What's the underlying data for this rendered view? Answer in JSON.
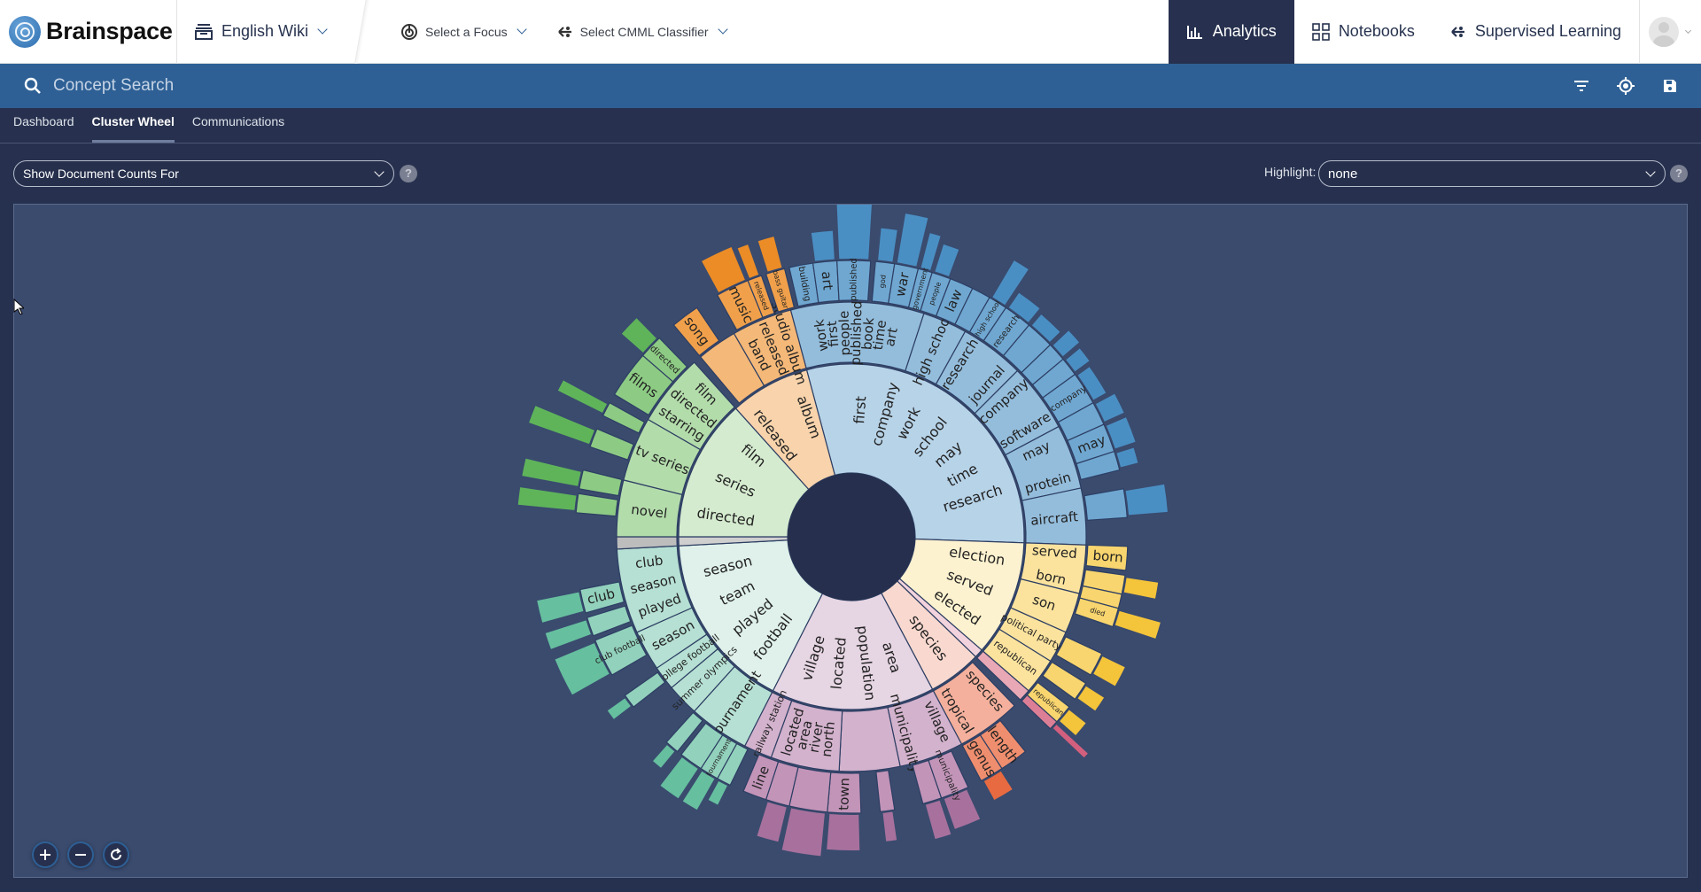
{
  "app": {
    "brand": "Brainspace"
  },
  "topbar": {
    "dataset": "English Wiki",
    "focus_select": "Select a Focus",
    "classifier_select": "Select CMML Classifier",
    "nav": [
      {
        "label": "Analytics",
        "icon": "bar-chart-icon",
        "active": true
      },
      {
        "label": "Notebooks",
        "icon": "grid-icon",
        "active": false
      },
      {
        "label": "Supervised Learning",
        "icon": "network-icon",
        "active": false
      }
    ]
  },
  "search": {
    "placeholder": "Concept Search",
    "value": ""
  },
  "tabs": [
    {
      "label": "Dashboard",
      "active": false
    },
    {
      "label": "Cluster Wheel",
      "active": true
    },
    {
      "label": "Communications",
      "active": false
    }
  ],
  "controls": {
    "doc_counts": "Show Document Counts For",
    "highlight_label": "Highlight:",
    "highlight_value": "none",
    "help": "?"
  },
  "colors": {
    "blue": [
      "#b7d3e8",
      "#94bddc",
      "#6fa7d1",
      "#4a8fc4"
    ],
    "orange": [
      "#f8d3ab",
      "#f4b878",
      "#f0a04b",
      "#eb8c26"
    ],
    "green": [
      "#d5ebcf",
      "#b3dcab",
      "#8dcb84",
      "#5fb45a"
    ],
    "mint": [
      "#dff1ea",
      "#b6e0d3",
      "#92d1bc",
      "#66bf9f"
    ],
    "lilac": [
      "#e6d5e3",
      "#d3b2cd",
      "#c294b8",
      "#a8719d"
    ],
    "peach": [
      "#f9d9cf",
      "#f4b09c",
      "#ef8e6e",
      "#e86a40"
    ],
    "pink": [
      "#f2d3dd",
      "#e9a8b6",
      "#dc7f96",
      "#d35f7e"
    ],
    "yellow": [
      "#fdf2d0",
      "#fbe39e",
      "#f8d56e",
      "#f4c43a"
    ],
    "gray": [
      "#cfcfcf",
      "#bdbdbd",
      "#aaaaaa",
      "#999999"
    ]
  },
  "chart_data": {
    "type": "sunburst",
    "title": "Cluster Wheel",
    "inner": [
      {
        "start": 345,
        "end": 92,
        "c": "blue",
        "labels": [
          "first",
          "company",
          "work",
          "school",
          "may",
          "time",
          "research"
        ]
      },
      {
        "start": 92,
        "end": 131,
        "c": "yellow",
        "labels": [
          "election",
          "served",
          "elected"
        ]
      },
      {
        "start": 131,
        "end": 134,
        "c": "pink",
        "labels": []
      },
      {
        "start": 134,
        "end": 152,
        "c": "peach",
        "labels": [
          "species"
        ]
      },
      {
        "start": 152,
        "end": 207,
        "c": "lilac",
        "labels": [
          "area",
          "population",
          "located",
          "village"
        ]
      },
      {
        "start": 207,
        "end": 267,
        "c": "mint",
        "labels": [
          "football",
          "played",
          "team",
          "season"
        ]
      },
      {
        "start": 267,
        "end": 270,
        "c": "gray",
        "labels": []
      },
      {
        "start": 270,
        "end": 318,
        "c": "green",
        "labels": [
          "directed",
          "series",
          "film"
        ]
      },
      {
        "start": 318,
        "end": 345,
        "c": "orange",
        "labels": [
          "released",
          "album"
        ]
      }
    ],
    "middle": [
      {
        "start": 345,
        "end": 18,
        "c": "blue",
        "labels": [
          "work",
          "first",
          "people",
          "published",
          "book",
          "time",
          "art"
        ]
      },
      {
        "start": 18,
        "end": 29,
        "c": "blue",
        "labels": [
          "high school"
        ]
      },
      {
        "start": 29,
        "end": 45,
        "c": "blue",
        "labels": [
          "research",
          "journal"
        ]
      },
      {
        "start": 45,
        "end": 62,
        "c": "blue",
        "labels": [
          "company",
          "software"
        ]
      },
      {
        "start": 62,
        "end": 78,
        "c": "blue",
        "labels": [
          "may",
          "protein"
        ]
      },
      {
        "start": 78,
        "end": 92,
        "c": "blue",
        "labels": [
          "aircraft"
        ]
      },
      {
        "start": 92,
        "end": 104,
        "c": "yellow",
        "labels": [
          "served",
          "born"
        ]
      },
      {
        "start": 104,
        "end": 114,
        "c": "yellow",
        "labels": [
          "son"
        ]
      },
      {
        "start": 114,
        "end": 122,
        "c": "yellow",
        "labels": [
          "political party"
        ]
      },
      {
        "start": 122,
        "end": 131,
        "c": "yellow",
        "labels": [
          "republican"
        ]
      },
      {
        "start": 131,
        "end": 134,
        "c": "pink",
        "labels": []
      },
      {
        "start": 136,
        "end": 152,
        "c": "peach",
        "labels": [
          "species",
          "tropical"
        ]
      },
      {
        "start": 152,
        "end": 168,
        "c": "lilac",
        "labels": [
          "village",
          "municipality"
        ]
      },
      {
        "start": 168,
        "end": 183,
        "c": "lilac",
        "labels": []
      },
      {
        "start": 183,
        "end": 200,
        "c": "lilac",
        "labels": [
          "north",
          "river",
          "area",
          "located"
        ]
      },
      {
        "start": 200,
        "end": 207,
        "c": "lilac",
        "labels": [
          "railway station"
        ]
      },
      {
        "start": 207,
        "end": 222,
        "c": "mint",
        "labels": [
          "tournament"
        ]
      },
      {
        "start": 222,
        "end": 230,
        "c": "mint",
        "labels": [
          "summer olympics"
        ]
      },
      {
        "start": 230,
        "end": 236,
        "c": "mint",
        "labels": [
          "college football"
        ]
      },
      {
        "start": 236,
        "end": 246,
        "c": "mint",
        "labels": [
          "season"
        ]
      },
      {
        "start": 246,
        "end": 267,
        "c": "mint",
        "labels": [
          "played",
          "season",
          "club"
        ]
      },
      {
        "start": 267,
        "end": 270,
        "c": "gray",
        "labels": []
      },
      {
        "start": 270,
        "end": 284,
        "c": "green",
        "labels": [
          "novel"
        ]
      },
      {
        "start": 284,
        "end": 300,
        "c": "green",
        "labels": [
          "tv series"
        ]
      },
      {
        "start": 300,
        "end": 318,
        "c": "green",
        "labels": [
          "starring",
          "directed",
          "film"
        ]
      },
      {
        "start": 320,
        "end": 330,
        "c": "orange",
        "labels": []
      },
      {
        "start": 330,
        "end": 345,
        "c": "orange",
        "labels": [
          "band",
          "released",
          "studio album"
        ]
      }
    ],
    "outer": [
      {
        "start": 347,
        "end": 352,
        "c": "blue",
        "label": "building",
        "bar": 0
      },
      {
        "start": 352,
        "end": 357,
        "c": "blue",
        "label": "art",
        "bar": 0.4
      },
      {
        "start": 357,
        "end": 4,
        "c": "blue",
        "label": "published",
        "bar": 1.0
      },
      {
        "start": 5,
        "end": 9,
        "c": "blue",
        "label": "god",
        "bar": 0.45
      },
      {
        "start": 9,
        "end": 14,
        "c": "blue",
        "label": "war",
        "bar": 0.7
      },
      {
        "start": 14,
        "end": 17,
        "c": "blue",
        "label": "government",
        "bar": 0.5
      },
      {
        "start": 17,
        "end": 21,
        "c": "blue",
        "label": "people",
        "bar": 0.4
      },
      {
        "start": 21,
        "end": 26,
        "c": "blue",
        "label": "law",
        "bar": 0
      },
      {
        "start": 26,
        "end": 30,
        "c": "blue",
        "label": "",
        "bar": 0
      },
      {
        "start": 30,
        "end": 34,
        "c": "blue",
        "label": "high school",
        "bar": 0.6
      },
      {
        "start": 34,
        "end": 40,
        "c": "blue",
        "label": "research",
        "bar": 0.25
      },
      {
        "start": 40,
        "end": 46,
        "c": "blue",
        "label": "",
        "bar": 0.2
      },
      {
        "start": 46,
        "end": 50,
        "c": "blue",
        "label": "",
        "bar": 0.3
      },
      {
        "start": 50,
        "end": 54,
        "c": "blue",
        "label": "",
        "bar": 0.25
      },
      {
        "start": 54,
        "end": 61,
        "c": "blue",
        "label": "company",
        "bar": 0.2
      },
      {
        "start": 61,
        "end": 66,
        "c": "blue",
        "label": "",
        "bar": 0.3
      },
      {
        "start": 66,
        "end": 72,
        "c": "blue",
        "label": "may",
        "bar": 0.3
      },
      {
        "start": 72,
        "end": 76,
        "c": "blue",
        "label": "",
        "bar": 0.25
      },
      {
        "start": 80,
        "end": 86,
        "c": "blue",
        "label": "",
        "bar": 0.55
      },
      {
        "start": 92,
        "end": 97,
        "c": "yellow",
        "label": "born",
        "bar": 0
      },
      {
        "start": 98,
        "end": 102,
        "c": "yellow",
        "label": "",
        "bar": 0.45
      },
      {
        "start": 102,
        "end": 105,
        "c": "yellow",
        "label": "",
        "bar": 0
      },
      {
        "start": 105,
        "end": 109,
        "c": "yellow",
        "label": "died",
        "bar": 0.6
      },
      {
        "start": 115,
        "end": 120,
        "c": "yellow",
        "label": "",
        "bar": 0.35
      },
      {
        "start": 122,
        "end": 126,
        "c": "yellow",
        "label": "",
        "bar": 0.3
      },
      {
        "start": 128,
        "end": 132,
        "c": "yellow",
        "label": "republican",
        "bar": 0.3
      },
      {
        "start": 132,
        "end": 134,
        "c": "pink",
        "label": "",
        "bar": 0.6
      },
      {
        "start": 141,
        "end": 147,
        "c": "peach",
        "label": "length",
        "bar": 0
      },
      {
        "start": 147,
        "end": 152,
        "c": "peach",
        "label": "genus",
        "bar": 0.3
      },
      {
        "start": 155,
        "end": 161,
        "c": "lilac",
        "label": "municipality",
        "bar": 0.45
      },
      {
        "start": 161,
        "end": 165,
        "c": "lilac",
        "label": "",
        "bar": 0.5
      },
      {
        "start": 171,
        "end": 174,
        "c": "lilac",
        "label": "",
        "bar": 0.4
      },
      {
        "start": 178,
        "end": 185,
        "c": "lilac",
        "label": "town",
        "bar": 0.5
      },
      {
        "start": 185,
        "end": 193,
        "c": "lilac",
        "label": "",
        "bar": 0.6
      },
      {
        "start": 193,
        "end": 198,
        "c": "lilac",
        "label": "",
        "bar": 0.5
      },
      {
        "start": 198,
        "end": 203,
        "c": "lilac",
        "label": "line",
        "bar": 0
      },
      {
        "start": 206,
        "end": 209,
        "c": "mint",
        "label": "",
        "bar": 0.3
      },
      {
        "start": 209,
        "end": 213,
        "c": "mint",
        "label": "tournament",
        "bar": 0.5
      },
      {
        "start": 213,
        "end": 218,
        "c": "mint",
        "label": "",
        "bar": 0.5
      },
      {
        "start": 219,
        "end": 222,
        "c": "mint",
        "label": "",
        "bar": 0.3
      },
      {
        "start": 232,
        "end": 235,
        "c": "mint",
        "label": "",
        "bar": 0.3
      },
      {
        "start": 240,
        "end": 248,
        "c": "mint",
        "label": "club football",
        "bar": 0.6
      },
      {
        "start": 249,
        "end": 253,
        "c": "mint",
        "label": "",
        "bar": 0.6
      },
      {
        "start": 254,
        "end": 259,
        "c": "mint",
        "label": "club",
        "bar": 0.6
      },
      {
        "start": 275,
        "end": 279,
        "c": "green",
        "label": "",
        "bar": 0.8
      },
      {
        "start": 280,
        "end": 284,
        "c": "green",
        "label": "",
        "bar": 0.8
      },
      {
        "start": 289,
        "end": 293,
        "c": "green",
        "label": "",
        "bar": 0.9
      },
      {
        "start": 296,
        "end": 299,
        "c": "green",
        "label": "",
        "bar": 0.7
      },
      {
        "start": 301,
        "end": 311,
        "c": "green",
        "label": "films",
        "bar": 0
      },
      {
        "start": 311,
        "end": 316,
        "c": "green",
        "label": "directed",
        "bar": 0.4
      },
      {
        "start": 320,
        "end": 326,
        "c": "orange",
        "label": "song",
        "bar": 0
      },
      {
        "start": 331,
        "end": 338,
        "c": "orange",
        "label": "music",
        "bar": 0.5
      },
      {
        "start": 338,
        "end": 341,
        "c": "orange",
        "label": "released",
        "bar": 0.45
      },
      {
        "start": 342,
        "end": 346,
        "c": "orange",
        "label": "bass guitar",
        "bar": 0.45
      }
    ]
  }
}
